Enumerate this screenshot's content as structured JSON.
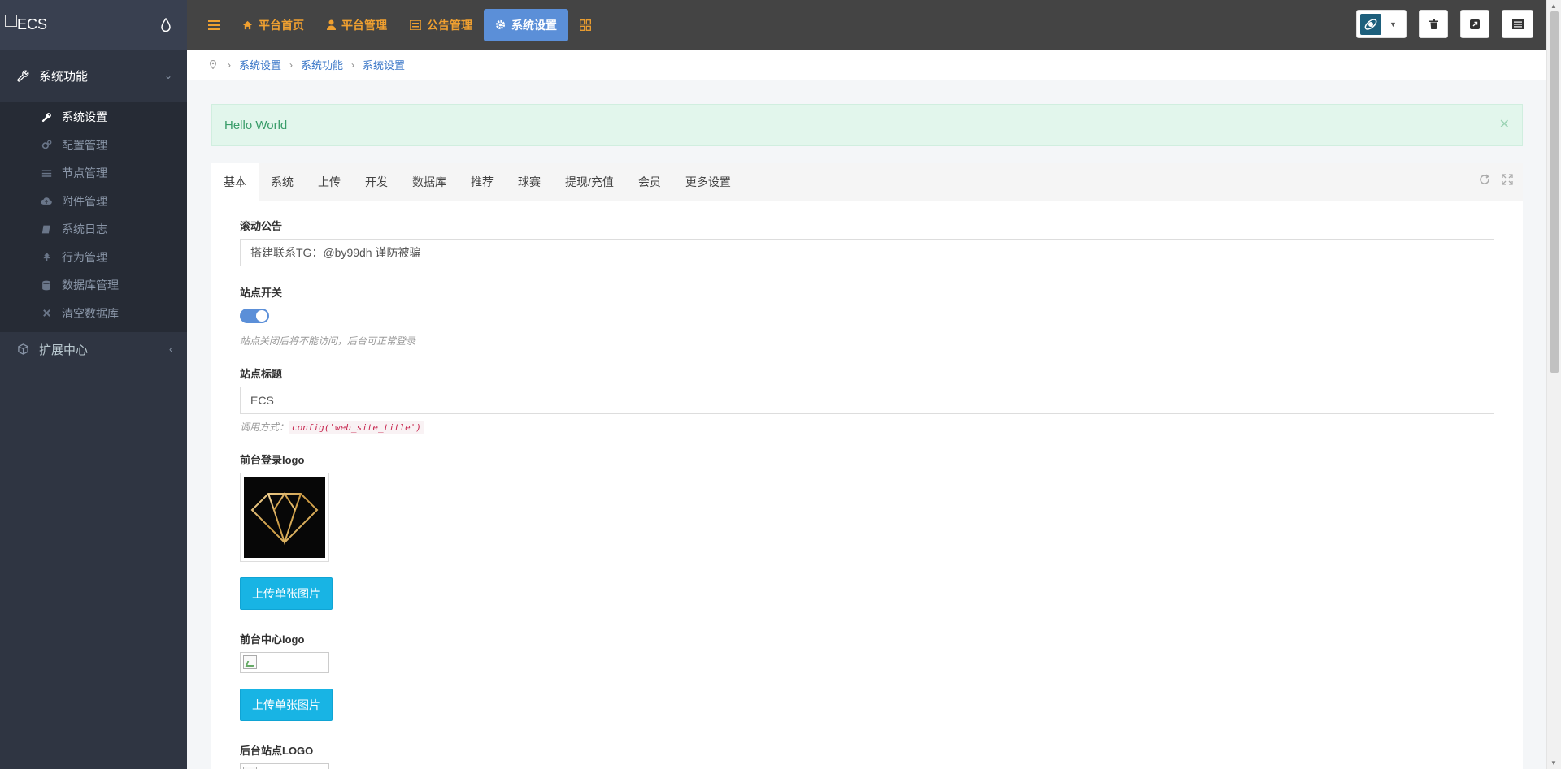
{
  "sidebar": {
    "logo_text": "ECS",
    "groups": [
      {
        "label": "系统功能",
        "icon": "wrench-icon",
        "items": [
          {
            "label": "系统设置",
            "icon": "wrench-icon",
            "active": true
          },
          {
            "label": "配置管理",
            "icon": "cogs-icon"
          },
          {
            "label": "节点管理",
            "icon": "bars-icon"
          },
          {
            "label": "附件管理",
            "icon": "cloud-upload-icon"
          },
          {
            "label": "系统日志",
            "icon": "book-icon"
          },
          {
            "label": "行为管理",
            "icon": "tree-icon"
          },
          {
            "label": "数据库管理",
            "icon": "database-icon"
          },
          {
            "label": "清空数据库",
            "icon": "times-icon"
          }
        ]
      },
      {
        "label": "扩展中心",
        "icon": "cubes-icon",
        "items": []
      }
    ]
  },
  "topbar": {
    "nav": [
      {
        "label": "平台首页",
        "icon": "home-icon"
      },
      {
        "label": "平台管理",
        "icon": "user-icon"
      },
      {
        "label": "公告管理",
        "icon": "list-icon"
      },
      {
        "label": "系统设置",
        "icon": "gear-icon",
        "active": true
      }
    ]
  },
  "breadcrumb": [
    "系统设置",
    "系统功能",
    "系统设置"
  ],
  "alert": {
    "message": "Hello World"
  },
  "tabs": [
    "基本",
    "系统",
    "上传",
    "开发",
    "数据库",
    "推荐",
    "球赛",
    "提现/充值",
    "会员",
    "更多设置"
  ],
  "form": {
    "announcement": {
      "label": "滚动公告",
      "value": "搭建联系TG：@by99dh 谨防被骗"
    },
    "site_switch": {
      "label": "站点开关",
      "on": true,
      "help": "站点关闭后将不能访问，后台可正常登录"
    },
    "site_title": {
      "label": "站点标题",
      "value": "ECS",
      "help_prefix": "调用方式：",
      "help_code": "config('web_site_title')"
    },
    "front_login_logo": {
      "label": "前台登录logo",
      "upload_label": "上传单张图片"
    },
    "front_center_logo": {
      "label": "前台中心logo",
      "upload_label": "上传单张图片"
    },
    "admin_logo": {
      "label": "后台站点LOGO"
    }
  },
  "colors": {
    "accent": "#5b8fd8",
    "nav_text": "#f0a030",
    "upload": "#18b4e4",
    "sidebar": "#2f3542"
  }
}
